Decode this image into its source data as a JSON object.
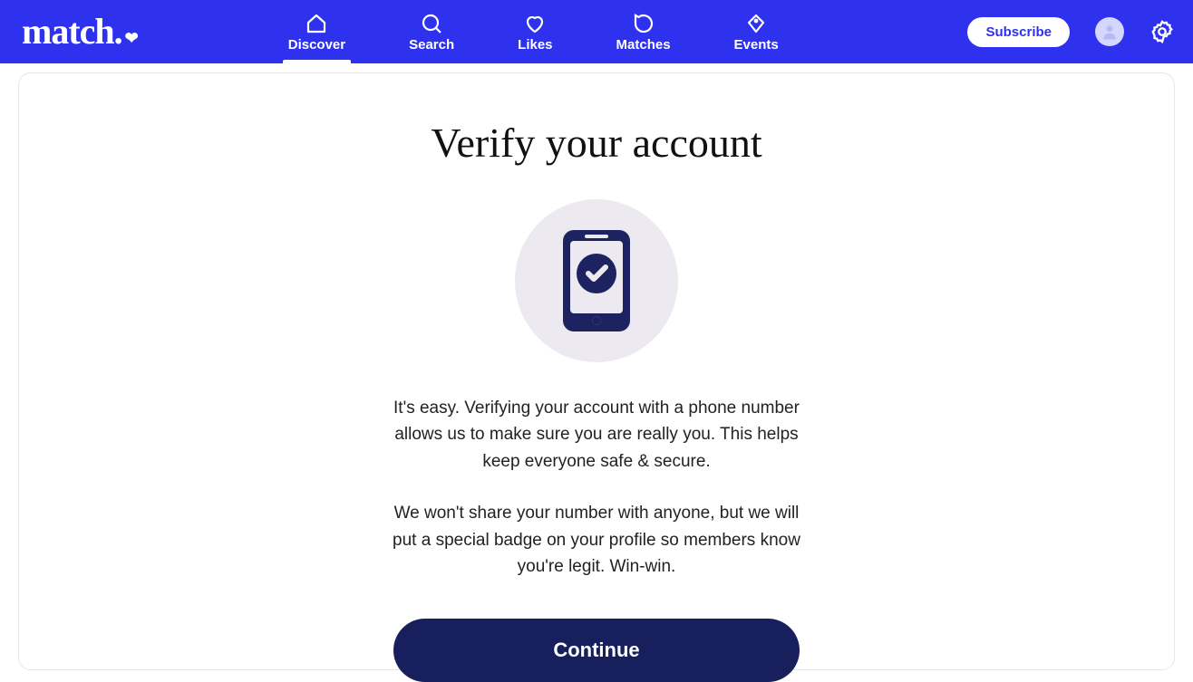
{
  "brand": {
    "name": "match."
  },
  "nav": {
    "items": [
      {
        "label": "Discover",
        "active": true
      },
      {
        "label": "Search",
        "active": false
      },
      {
        "label": "Likes",
        "active": false
      },
      {
        "label": "Matches",
        "active": false
      },
      {
        "label": "Events",
        "active": false
      }
    ]
  },
  "header": {
    "subscribe_label": "Subscribe"
  },
  "verify": {
    "title": "Verify your account",
    "para1": "It's easy. Verifying your account with a phone number allows us to make sure you are really you. This helps keep everyone safe & secure.",
    "para2": "We won't share your number with anyone, but we will put a special badge on your profile so members know you're legit. Win-win.",
    "continue_label": "Continue"
  }
}
